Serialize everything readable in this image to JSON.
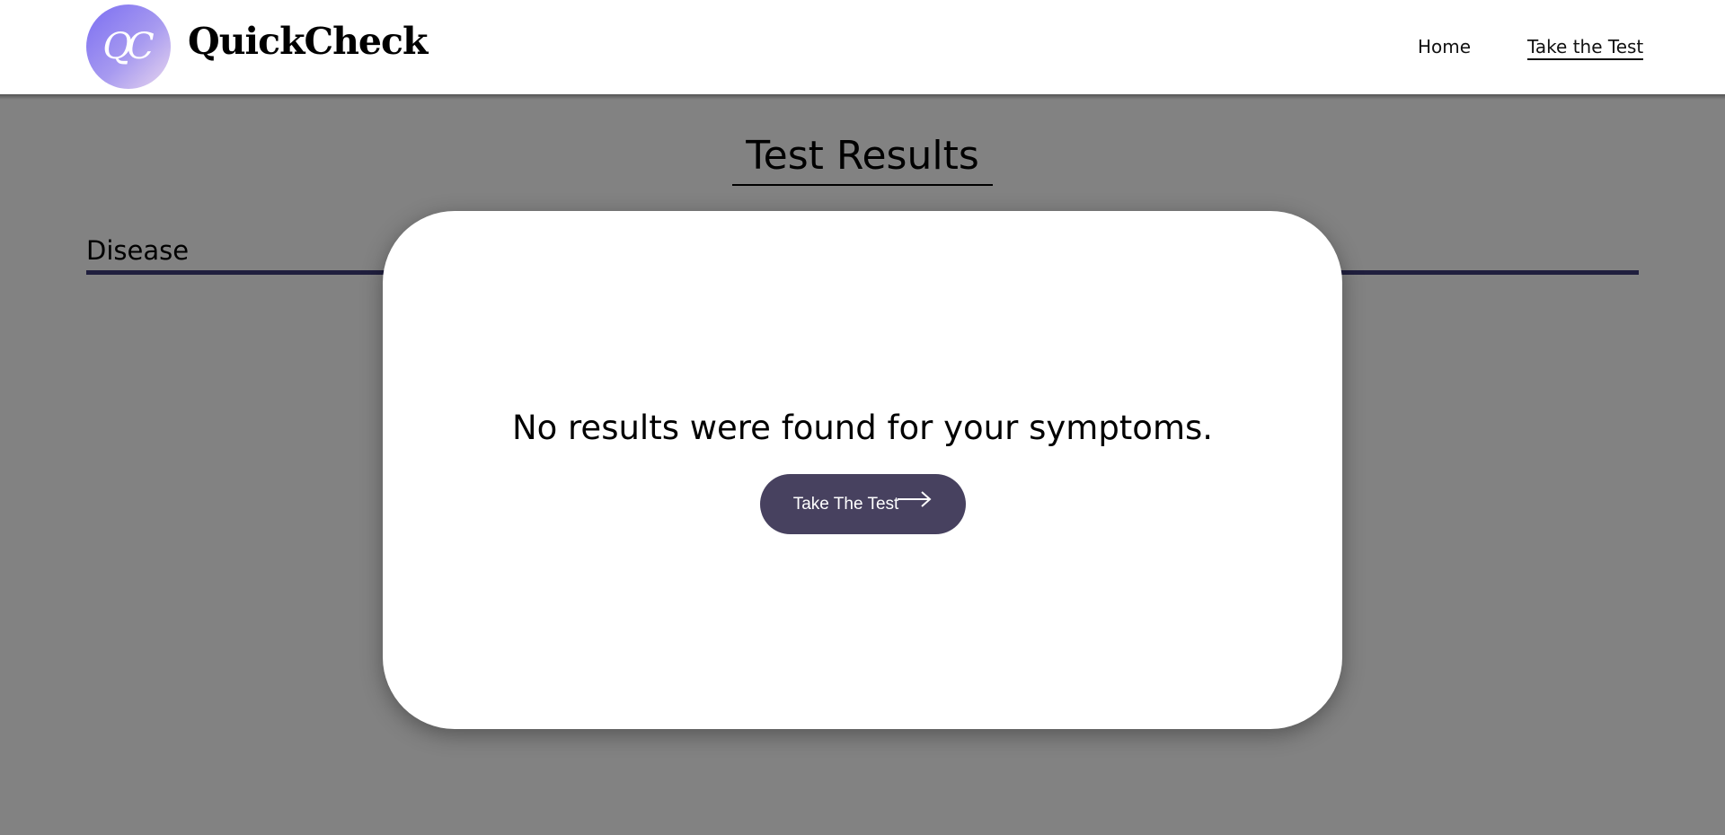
{
  "header": {
    "logo_monogram": "QC",
    "brand": "QuickCheck",
    "nav": [
      {
        "label": "Home"
      },
      {
        "label": "Take the Test",
        "active": true
      }
    ]
  },
  "main": {
    "title": "Test Results",
    "section_heading": "Disease"
  },
  "modal": {
    "message": "No results were found for your symptoms.",
    "button_label": "Take The Test",
    "button_icon": "arrow-right-icon"
  },
  "colors": {
    "accent": "#47415f",
    "rule": "#3f3d7a",
    "logo_gradient_start": "#7b6ef2",
    "logo_gradient_end": "#e8d6ee"
  }
}
